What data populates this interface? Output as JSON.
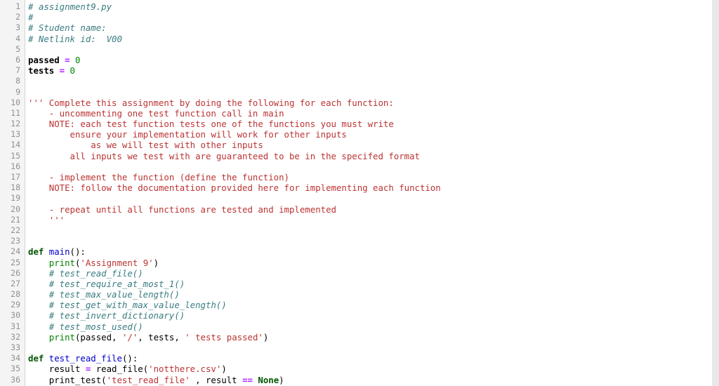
{
  "editor": {
    "filename": "assignment9.py",
    "language": "python",
    "first_line": 1,
    "last_line": 36,
    "gutter_label": "line-numbers",
    "scrollbar_label": "vertical-scrollbar"
  },
  "colors": {
    "background": "#ffffff",
    "gutter_background": "#f4f4f4",
    "gutter_text": "#909090",
    "gutter_border": "#d4d4d4",
    "comment": "#3a7c80",
    "string": "#bb3333",
    "keyword": "#005500",
    "builtin": "#008000",
    "definition": "#0000cc",
    "number": "#008800",
    "operator": "#aa22ff",
    "plain": "#000000",
    "scrollbar": "#e8e8e8"
  },
  "lines": [
    {
      "n": 1,
      "tokens": [
        {
          "t": "# assignment9.py",
          "c": "comment"
        }
      ]
    },
    {
      "n": 2,
      "tokens": [
        {
          "t": "#",
          "c": "comment"
        }
      ]
    },
    {
      "n": 3,
      "tokens": [
        {
          "t": "# Student name:",
          "c": "comment"
        }
      ]
    },
    {
      "n": 4,
      "tokens": [
        {
          "t": "# Netlink id:  V00",
          "c": "comment"
        }
      ]
    },
    {
      "n": 5,
      "tokens": []
    },
    {
      "n": 6,
      "tokens": [
        {
          "t": "passed ",
          "c": "bold"
        },
        {
          "t": "=",
          "c": "op"
        },
        {
          "t": " ",
          "c": "plain"
        },
        {
          "t": "0",
          "c": "number"
        }
      ]
    },
    {
      "n": 7,
      "tokens": [
        {
          "t": "tests ",
          "c": "bold"
        },
        {
          "t": "=",
          "c": "op"
        },
        {
          "t": " ",
          "c": "plain"
        },
        {
          "t": "0",
          "c": "number"
        }
      ]
    },
    {
      "n": 8,
      "tokens": []
    },
    {
      "n": 9,
      "tokens": []
    },
    {
      "n": 10,
      "tokens": [
        {
          "t": "''' Complete this assignment by doing the following for each function:",
          "c": "doc"
        }
      ]
    },
    {
      "n": 11,
      "tokens": [
        {
          "t": "    - uncommenting one test function call in main",
          "c": "doc"
        }
      ]
    },
    {
      "n": 12,
      "tokens": [
        {
          "t": "    NOTE: each test function tests one of the functions you must write",
          "c": "doc"
        }
      ]
    },
    {
      "n": 13,
      "tokens": [
        {
          "t": "        ensure your implementation will work for other inputs",
          "c": "doc"
        }
      ]
    },
    {
      "n": 14,
      "tokens": [
        {
          "t": "            as we will test with other inputs",
          "c": "doc"
        }
      ]
    },
    {
      "n": 15,
      "tokens": [
        {
          "t": "        all inputs we test with are guaranteed to be in the specifed format",
          "c": "doc"
        }
      ]
    },
    {
      "n": 16,
      "tokens": []
    },
    {
      "n": 17,
      "tokens": [
        {
          "t": "    - implement the function (define the function)",
          "c": "doc"
        }
      ]
    },
    {
      "n": 18,
      "tokens": [
        {
          "t": "    NOTE: follow the documentation provided here for implementing each function",
          "c": "doc"
        }
      ]
    },
    {
      "n": 19,
      "tokens": []
    },
    {
      "n": 20,
      "tokens": [
        {
          "t": "    - repeat until all functions are tested and implemented",
          "c": "doc"
        }
      ]
    },
    {
      "n": 21,
      "tokens": [
        {
          "t": "    '''",
          "c": "doc"
        }
      ]
    },
    {
      "n": 22,
      "tokens": []
    },
    {
      "n": 23,
      "tokens": []
    },
    {
      "n": 24,
      "tokens": [
        {
          "t": "def",
          "c": "keyword"
        },
        {
          "t": " ",
          "c": "plain"
        },
        {
          "t": "main",
          "c": "defname"
        },
        {
          "t": "():",
          "c": "plain"
        }
      ]
    },
    {
      "n": 25,
      "tokens": [
        {
          "t": "    ",
          "c": "plain"
        },
        {
          "t": "print",
          "c": "builtin"
        },
        {
          "t": "(",
          "c": "plain"
        },
        {
          "t": "'Assignment 9'",
          "c": "string"
        },
        {
          "t": ")",
          "c": "plain"
        }
      ]
    },
    {
      "n": 26,
      "tokens": [
        {
          "t": "    # test_read_file()",
          "c": "comment"
        }
      ]
    },
    {
      "n": 27,
      "tokens": [
        {
          "t": "    # test_require_at_most_1()",
          "c": "comment"
        }
      ]
    },
    {
      "n": 28,
      "tokens": [
        {
          "t": "    # test_max_value_length()",
          "c": "comment"
        }
      ]
    },
    {
      "n": 29,
      "tokens": [
        {
          "t": "    # test_get_with_max_value_length()",
          "c": "comment"
        }
      ]
    },
    {
      "n": 30,
      "tokens": [
        {
          "t": "    # test_invert_dictionary()",
          "c": "comment"
        }
      ]
    },
    {
      "n": 31,
      "tokens": [
        {
          "t": "    # test_most_used()",
          "c": "comment"
        }
      ]
    },
    {
      "n": 32,
      "tokens": [
        {
          "t": "    ",
          "c": "plain"
        },
        {
          "t": "print",
          "c": "builtin"
        },
        {
          "t": "(passed, ",
          "c": "plain"
        },
        {
          "t": "'/'",
          "c": "string"
        },
        {
          "t": ", tests, ",
          "c": "plain"
        },
        {
          "t": "' tests passed'",
          "c": "string"
        },
        {
          "t": ")",
          "c": "plain"
        }
      ]
    },
    {
      "n": 33,
      "tokens": []
    },
    {
      "n": 34,
      "tokens": [
        {
          "t": "def",
          "c": "keyword"
        },
        {
          "t": " ",
          "c": "plain"
        },
        {
          "t": "test_read_file",
          "c": "defname"
        },
        {
          "t": "():",
          "c": "plain"
        }
      ]
    },
    {
      "n": 35,
      "tokens": [
        {
          "t": "    result ",
          "c": "plain"
        },
        {
          "t": "=",
          "c": "op"
        },
        {
          "t": " read_file(",
          "c": "plain"
        },
        {
          "t": "'notthere.csv'",
          "c": "string"
        },
        {
          "t": ")",
          "c": "plain"
        }
      ]
    },
    {
      "n": 36,
      "tokens": [
        {
          "t": "    print_test(",
          "c": "plain"
        },
        {
          "t": "'test_read_file'",
          "c": "string"
        },
        {
          "t": " , result ",
          "c": "plain"
        },
        {
          "t": "==",
          "c": "op"
        },
        {
          "t": " ",
          "c": "plain"
        },
        {
          "t": "None",
          "c": "none"
        },
        {
          "t": ")",
          "c": "plain"
        }
      ]
    }
  ]
}
